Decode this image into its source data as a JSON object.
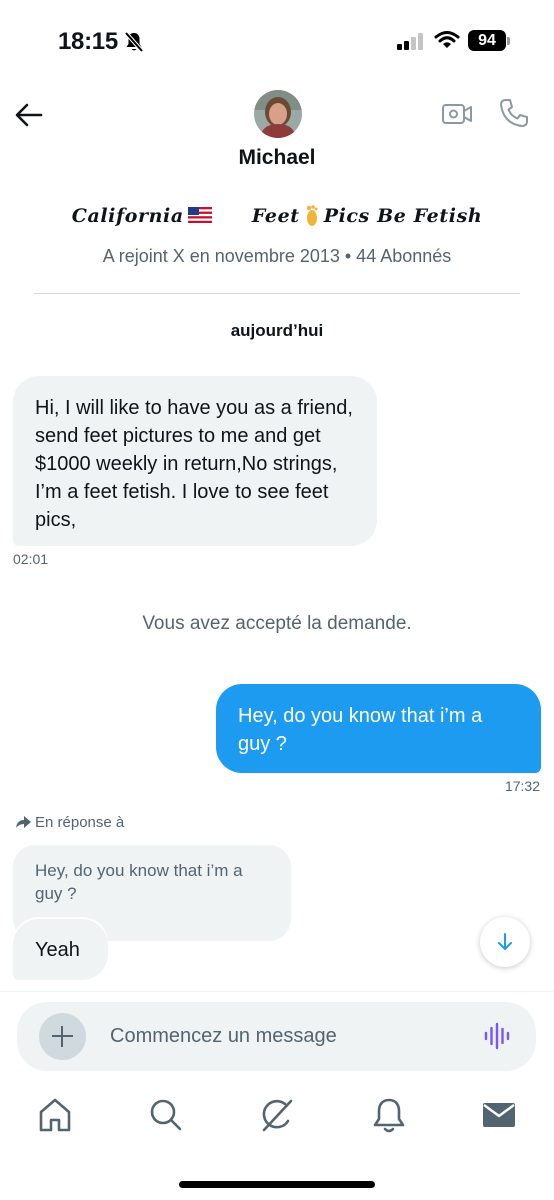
{
  "status_bar": {
    "time": "18:15",
    "battery": "94"
  },
  "header": {
    "name": "Michael",
    "bio_left": "California",
    "bio_mid": "Feet",
    "bio_right": "Pics Be Fetish",
    "joined": "A rejoint X en novembre 2013 • 44 Abonnés"
  },
  "conversation": {
    "date_separator": "aujourd’hui",
    "messages": [
      {
        "direction": "incoming",
        "text": "Hi, I will like to have you as a friend, send feet pictures to me and get $1000 weekly in return,No strings, I’m a feet fetish. I love to see feet pics,",
        "time": "02:01"
      },
      {
        "direction": "system",
        "text": "Vous avez accepté la demande."
      },
      {
        "direction": "outgoing",
        "text": "Hey, do you know that i’m a guy ?",
        "time": "17:32"
      },
      {
        "direction": "incoming",
        "reply_label": "En réponse à",
        "quoted_text": "Hey, do you know that i’m a guy ?",
        "text": "Yeah"
      }
    ]
  },
  "composer": {
    "placeholder": "Commencez un message"
  },
  "nav_icons": [
    "home-icon",
    "search-icon",
    "grok-icon",
    "bell-icon",
    "mail-icon"
  ],
  "colors": {
    "accent": "#1d9bf0",
    "voice": "#7856ff",
    "bubble_in": "#eff3f4",
    "secondary_text": "#536471"
  }
}
